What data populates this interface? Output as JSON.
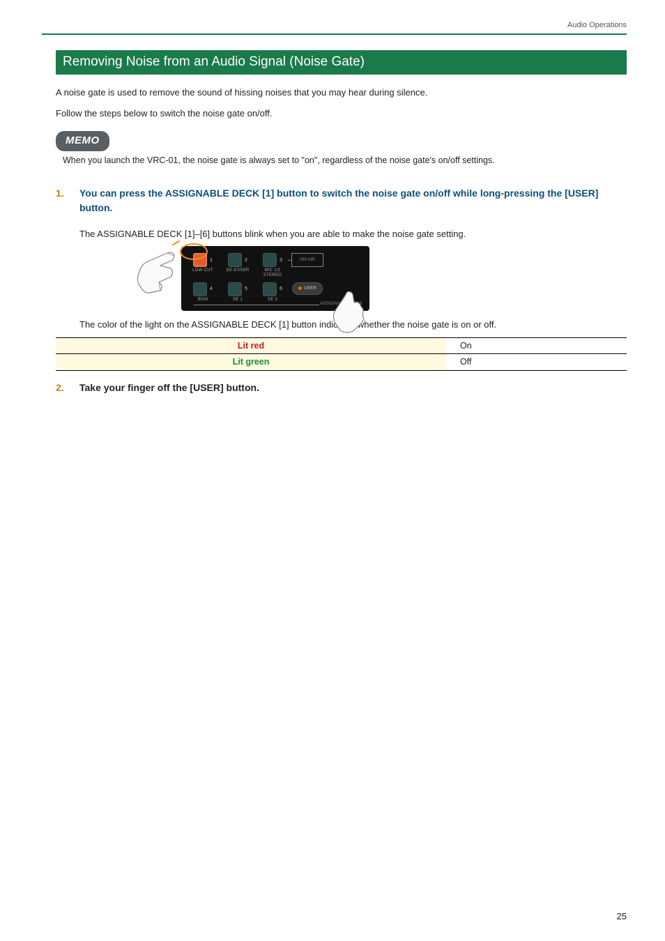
{
  "header": {
    "breadcrumb": "Audio Operations"
  },
  "section": {
    "title": "Removing Noise from an Audio Signal (Noise Gate)"
  },
  "intro": {
    "p1": "A noise gate is used to remove the sound of hissing noises that you may hear during silence.",
    "p2": "Follow the steps below to switch the noise gate on/off."
  },
  "memo": {
    "badge": "MEMO",
    "text": "When you launch the VRC-01, the noise gate is always set to \"on\", regardless of the noise gate's on/off settings."
  },
  "steps": {
    "s1": {
      "num": "1.",
      "text": "You can press the ASSIGNABLE DECK [1] button to switch the noise gate on/off while long-pressing the [USER] button.",
      "sub1": "The ASSIGNABLE DECK [1]–[6] buttons blink when you are able to make the noise gate setting.",
      "sub2": "The color of the light on the ASSIGNABLE DECK [1] button indicates whether the noise gate is on or off."
    },
    "s2": {
      "num": "2.",
      "text": "Take your finger off the [USER] button."
    }
  },
  "device": {
    "buttons": {
      "b1": {
        "num": "1",
        "label": "LOW CUT"
      },
      "b2": {
        "num": "2",
        "label": "DE-ESSER"
      },
      "b3": {
        "num": "3",
        "label": "MIC 1/2\nSTEREO"
      },
      "b4": {
        "num": "4",
        "label": "BGM"
      },
      "b5": {
        "num": "5",
        "label": "SE 1"
      },
      "b6": {
        "num": "6",
        "label": "SE 2"
      }
    },
    "onair": "ON AIR",
    "user": "USER",
    "assignable": "ASSIGNABLE DECK"
  },
  "table": {
    "r1": {
      "label": "Lit red",
      "value": "On"
    },
    "r2": {
      "label": "Lit green",
      "value": "Off"
    }
  },
  "page": "25"
}
